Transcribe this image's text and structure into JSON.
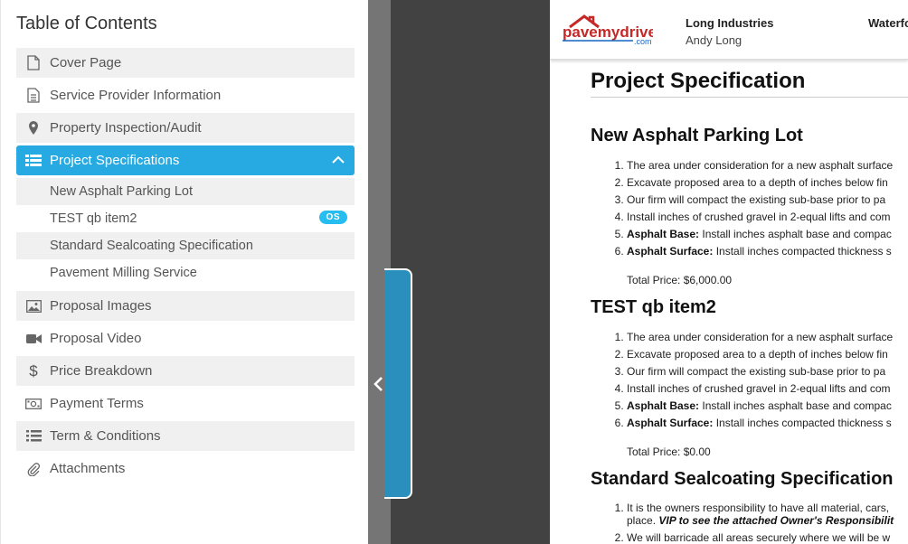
{
  "toc": {
    "title": "Table of Contents",
    "items": [
      {
        "label": "Cover Page",
        "icon": "file-icon"
      },
      {
        "label": "Service Provider Information",
        "icon": "file-text-icon"
      },
      {
        "label": "Property Inspection/Audit",
        "icon": "map-pin-icon"
      },
      {
        "label": "Project Specifications",
        "icon": "list-icon"
      },
      {
        "label": "Proposal Images",
        "icon": "image-icon"
      },
      {
        "label": "Proposal Video",
        "icon": "video-icon"
      },
      {
        "label": "Price Breakdown",
        "icon": "dollar-icon"
      },
      {
        "label": "Payment Terms",
        "icon": "money-icon"
      },
      {
        "label": "Term & Conditions",
        "icon": "list-bullet-icon"
      },
      {
        "label": "Attachments",
        "icon": "paperclip-icon"
      }
    ],
    "sub_items": [
      {
        "label": "New Asphalt Parking Lot"
      },
      {
        "label": "TEST qb item2",
        "badge": "OS"
      },
      {
        "label": "Standard Sealcoating Specification"
      },
      {
        "label": "Pavement Milling Service"
      }
    ]
  },
  "colors": {
    "accent": "#27a9e1",
    "badge": "#27bdf0",
    "tab": "#2b8fbd"
  },
  "doc": {
    "logo_text": "pavemydrive",
    "logo_sub": ".com",
    "company": "Long Industries",
    "person": "Andy Long",
    "location": "Waterfo",
    "title": "Project Specification",
    "sections": [
      {
        "heading": "New Asphalt Parking Lot",
        "items": [
          {
            "bold": "",
            "text": "The area under consideration for a new asphalt surface"
          },
          {
            "bold": "",
            "text": "Excavate proposed area to a depth of inches below fin"
          },
          {
            "bold": "",
            "text": "Our firm will compact the existing sub-base prior to pa"
          },
          {
            "bold": "",
            "text": "Install inches of crushed gravel in 2-equal lifts and com"
          },
          {
            "bold": "Asphalt Base:",
            "text": " Install inches asphalt base and compac"
          },
          {
            "bold": "Asphalt Surface:",
            "text": " Install inches compacted thickness s"
          }
        ],
        "price": "Total Price: $6,000.00"
      },
      {
        "heading": "TEST qb item2",
        "items": [
          {
            "bold": "",
            "text": "The area under consideration for a new asphalt surface"
          },
          {
            "bold": "",
            "text": "Excavate proposed area to a depth of inches below fin"
          },
          {
            "bold": "",
            "text": "Our firm will compact the existing sub-base prior to pa"
          },
          {
            "bold": "",
            "text": "Install inches of crushed gravel in 2-equal lifts and com"
          },
          {
            "bold": "Asphalt Base:",
            "text": " Install inches asphalt base and compac"
          },
          {
            "bold": "Asphalt Surface:",
            "text": " Install inches compacted thickness s"
          }
        ],
        "price": "Total Price: $0.00"
      },
      {
        "heading": "Standard Sealcoating Specification",
        "item1_line1": "It is the owners responsibility to have all material, cars,",
        "item1_line2a": "place. ",
        "item1_line2b": "VIP to see the attached Owner's Responsibilit",
        "item2": "We will barricade all areas securely where we will be w"
      }
    ]
  }
}
